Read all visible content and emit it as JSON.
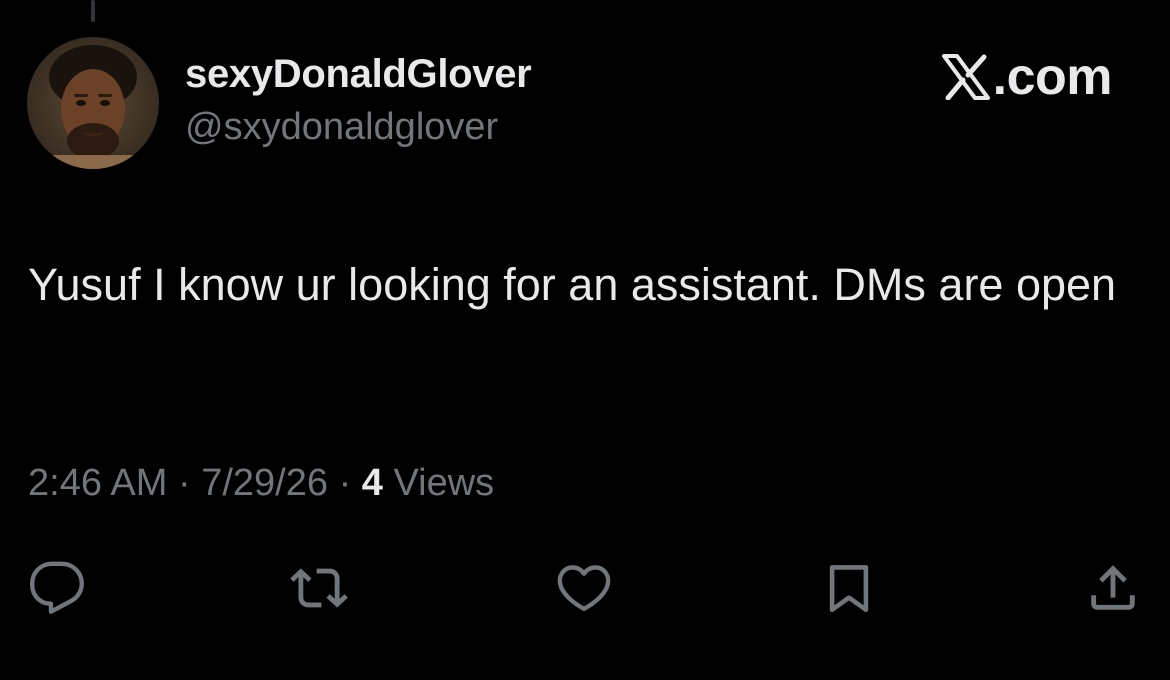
{
  "colors": {
    "background": "#000000",
    "primary_text": "#e7e9ea",
    "secondary_text": "#71767b",
    "icon": "#71767b"
  },
  "author": {
    "display_name": "sexyDonaldGlover",
    "handle": "@sxydonaldglover",
    "avatar": "profile-photo"
  },
  "brand": {
    "logo_icon": "x-logo-icon",
    "text": ".com"
  },
  "tweet": {
    "text": "Yusuf I know ur looking for an assistant. DMs are open"
  },
  "meta": {
    "time": "2:46 AM",
    "separator": "·",
    "date": "7/29/26",
    "views_count": "4",
    "views_label": "Views"
  },
  "actions": [
    {
      "name": "reply",
      "icon": "reply-icon"
    },
    {
      "name": "repost",
      "icon": "repost-icon"
    },
    {
      "name": "like",
      "icon": "heart-icon"
    },
    {
      "name": "bookmark",
      "icon": "bookmark-icon"
    },
    {
      "name": "share",
      "icon": "share-icon"
    }
  ]
}
